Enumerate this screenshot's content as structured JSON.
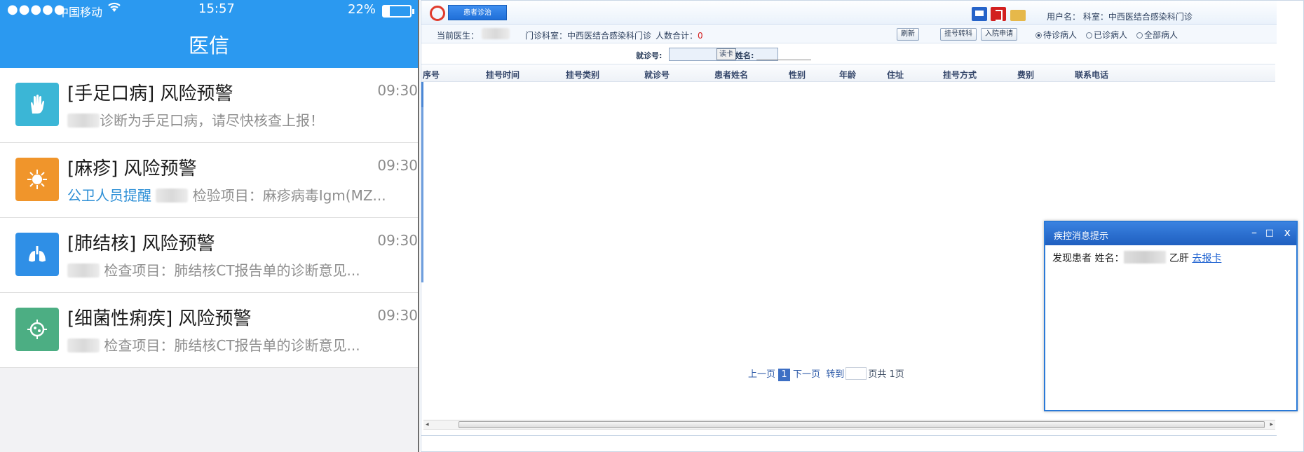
{
  "phone": {
    "status": {
      "signal": "●●●●●",
      "carrier": "中国移动",
      "wifi_icon": "wifi-icon",
      "time": "15:57",
      "battery": "22%"
    },
    "app_title": "医信",
    "messages": [
      {
        "title": "[手足口病] 风险预警",
        "time": "09:30",
        "sub": "诊断为手足口病，请尽快核查上报！",
        "icon": "hand-icon",
        "color": "#3bb6d6"
      },
      {
        "title": "[麻疹] 风险预警",
        "time": "09:30",
        "sub_link": "公卫人员提醒",
        "sub": " 检验项目：麻疹病毒Igm(MZ...",
        "icon": "virus-icon",
        "color": "#f0952b"
      },
      {
        "title": "[肺结核] 风险预警",
        "time": "09:30",
        "sub": " 检查项目：肺结核CT报告单的诊断意见...",
        "icon": "lungs-icon",
        "color": "#2f8fe6"
      },
      {
        "title": "[细菌性痢疾] 风险预警",
        "time": "09:30",
        "sub": " 检查项目：肺结核CT报告单的诊断意见...",
        "icon": "bacteria-icon",
        "color": "#4cae83"
      }
    ]
  },
  "desktop": {
    "tab_label": "患者诊治",
    "user_info": "用户名：      科室：中西医结合感染科门诊",
    "info": {
      "doctor_label": "当前医生：",
      "dept_label": "门诊科室：中西医结合感染科门诊",
      "count_label": "人数合计：",
      "count_value": "0"
    },
    "buttons": {
      "refresh": "刷新",
      "transfer": "挂号转科",
      "admission": "入院申请"
    },
    "radios": [
      {
        "label": "待诊病人",
        "checked": true
      },
      {
        "label": "已诊病人",
        "checked": false
      },
      {
        "label": "全部病人",
        "checked": false
      }
    ],
    "search": {
      "visit_no_label": "就诊号:",
      "read_card": "读卡",
      "name_label": "姓名:"
    },
    "columns": [
      "序号",
      "挂号时间",
      "挂号类别",
      "就诊号",
      "患者姓名",
      "性别",
      "年龄",
      "住址",
      "挂号方式",
      "费别",
      "联系电话"
    ],
    "pager": {
      "prev": "上一页",
      "current": "1",
      "next": "下一页",
      "goto": "转到",
      "total": "页共 1页"
    },
    "popup": {
      "title": "疾控消息提示",
      "minimize": "–",
      "maximize": "□",
      "close": "x",
      "text_prefix": "发现患者 姓名：",
      "disease": "乙肝",
      "link": "去报卡"
    }
  }
}
